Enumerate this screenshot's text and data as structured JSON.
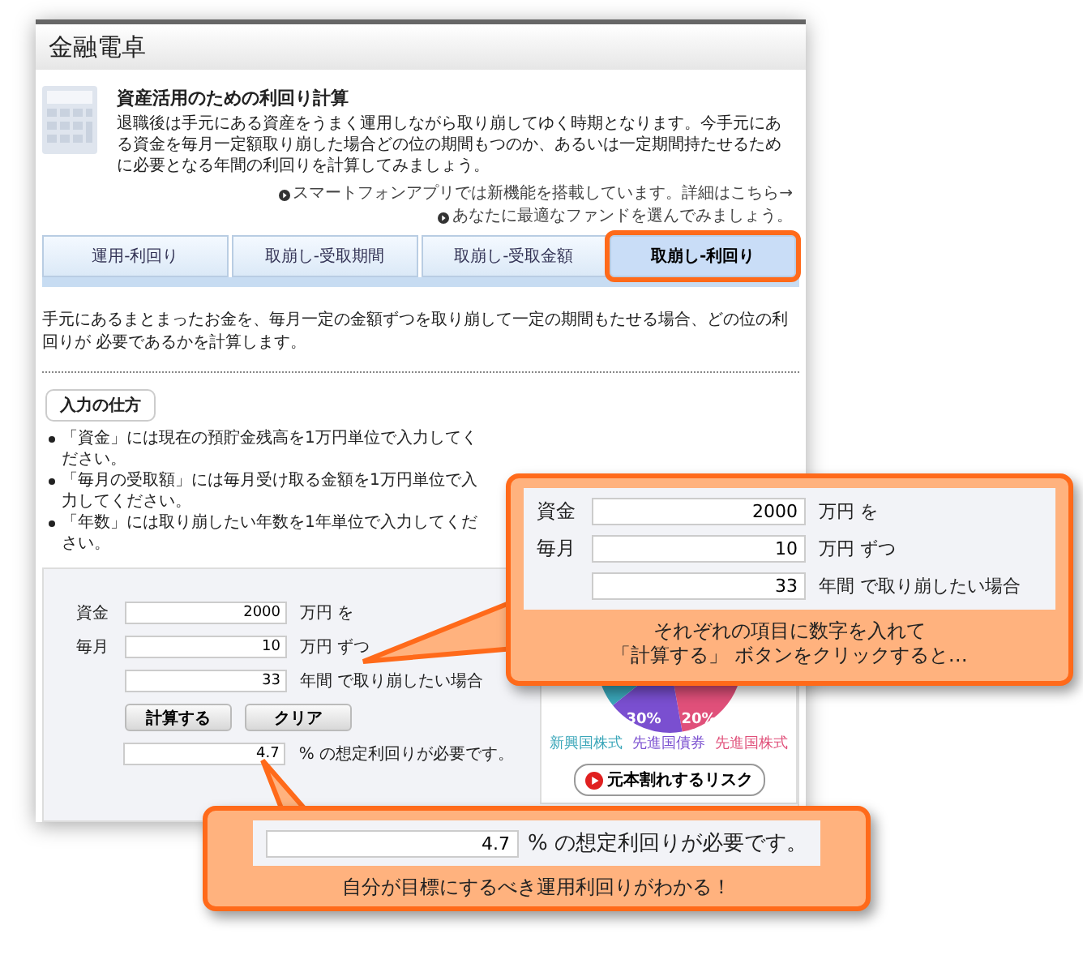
{
  "header": {
    "title": "金融電卓"
  },
  "intro": {
    "title": "資産活用のための利回り計算",
    "text": "退職後は手元にある資産をうまく運用しながら取り崩してゆく時期となります。今手元にある資金を毎月一定額取り崩した場合どの位の期間もつのか、あるいは一定期間持たせるために必要となる年間の利回りを計算してみましょう。"
  },
  "links": [
    "スマートフォンアプリでは新機能を搭載しています。詳細はこちら→",
    "あなたに最適なファンドを選んでみましょう。"
  ],
  "tabs": [
    {
      "label": "運用-利回り",
      "selected": false
    },
    {
      "label": "取崩し-受取期間",
      "selected": false
    },
    {
      "label": "取崩し-受取金額",
      "selected": false
    },
    {
      "label": "取崩し-利回り",
      "selected": true
    }
  ],
  "description": "手元にあるまとまったお金を、毎月一定の金額ずつを取り崩して一定の期間もたせる場合、どの位の利回りが 必要であるかを計算します。",
  "howto": {
    "title": "入力の仕方",
    "items": [
      "「資金」には現在の預貯金残高を1万円単位で入力してください。",
      "「毎月の受取額」には毎月受け取る金額を1万円単位で入力してください。",
      "「年数」には取り崩したい年数を1年単位で入力してください。"
    ]
  },
  "form": {
    "rows": [
      {
        "label": "資金",
        "value": "2000",
        "unit": "万円 を"
      },
      {
        "label": "毎月",
        "value": "10",
        "unit": "万円 ずつ"
      },
      {
        "value": "33",
        "unit": "年間 で取り崩したい場合"
      }
    ],
    "buttons": [
      "計算する",
      "クリア"
    ],
    "result": {
      "value": "4.7",
      "suffix": "% の想定利回りが必要です。"
    }
  },
  "side_panel": {
    "slice_labels": [
      "30%",
      "20%"
    ],
    "legend": [
      {
        "label": "新興国株式",
        "color": "#3aa6b9"
      },
      {
        "label": "先進国債券",
        "color": "#7a4fd0"
      },
      {
        "label": "先進国株式",
        "color": "#e0507a"
      }
    ],
    "risk_button": "元本割れするリスク"
  },
  "callouts": [
    {
      "rows": [
        {
          "label": "資金",
          "value": "2000",
          "unit": "万円 を"
        },
        {
          "label": "毎月",
          "value": "10",
          "unit": "万円 ずつ"
        },
        {
          "value": "33",
          "unit": "年間 で取り崩したい場合"
        }
      ],
      "caption_lines": [
        "それぞれの項目に数字を入れて",
        "「計算する」 ボタンをクリックすると…"
      ]
    },
    {
      "result": {
        "value": "4.7",
        "suffix": "% の想定利回りが必要です。"
      },
      "caption_lines": [
        "自分が目標にするべき運用利回りがわかる！"
      ]
    }
  ]
}
